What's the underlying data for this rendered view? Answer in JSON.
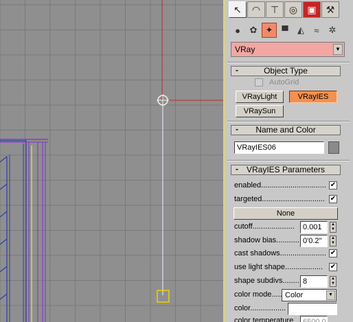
{
  "command_tabs": [
    {
      "icon": "cursor-arrow-icon",
      "glyph": "↖",
      "active": true
    },
    {
      "icon": "modify-rainbow-icon",
      "glyph": "◠",
      "active": false
    },
    {
      "icon": "hierarchy-icon",
      "glyph": "⊤",
      "active": false
    },
    {
      "icon": "motion-icon",
      "glyph": "◎",
      "active": false
    },
    {
      "icon": "display-monitor-icon",
      "glyph": "▣",
      "active": false
    },
    {
      "icon": "utilities-hammer-icon",
      "glyph": "⚒",
      "active": false
    }
  ],
  "create_categories": [
    {
      "icon": "geometry-sphere-icon",
      "glyph": "●"
    },
    {
      "icon": "shapes-icon",
      "glyph": "✿"
    },
    {
      "icon": "lights-icon",
      "glyph": "✦",
      "active": true
    },
    {
      "icon": "cameras-icon",
      "glyph": "▀"
    },
    {
      "icon": "helpers-icon",
      "glyph": "◭"
    },
    {
      "icon": "spacewarps-icon",
      "glyph": "≈"
    },
    {
      "icon": "systems-icon",
      "glyph": "✲"
    }
  ],
  "category_dropdown": {
    "value": "VRay"
  },
  "object_type": {
    "title": "Object Type",
    "autogrid_label": "AutoGrid",
    "buttons": [
      "VRayLight",
      "VRayIES",
      "VRaySun"
    ]
  },
  "name_and_color": {
    "title": "Name and Color",
    "name_value": "VRayIES06"
  },
  "params": {
    "title": "VRayIES Parameters",
    "enabled_label": "enabled................................",
    "enabled_checked": true,
    "targeted_label": "targeted................................",
    "targeted_checked": true,
    "none_button": "None",
    "cutoff_label": "cutoff....................",
    "cutoff_value": "0.001",
    "shadow_bias_label": "shadow bias.............",
    "shadow_bias_value": "0'0.2\"",
    "cast_shadows_label": "cast shadows......................",
    "cast_shadows_checked": true,
    "use_light_shape_label": "use light shape..................",
    "use_light_shape_checked": true,
    "shape_subdivs_label": "shape subdivs.........",
    "shape_subdivs_value": "8",
    "color_mode_label": "color mode.......",
    "color_mode_value": "Color",
    "color_label": "color...................",
    "color_temperature_label": "color temperature",
    "color_temperature_value": "6500.0"
  },
  "colors": {
    "viewport_bg": "#8f8f8f",
    "grid_line": "#7a7a7a",
    "selected_red": "#c02828",
    "active_orange": "#f5904e",
    "dropdown_pink": "#f2a7a4"
  }
}
